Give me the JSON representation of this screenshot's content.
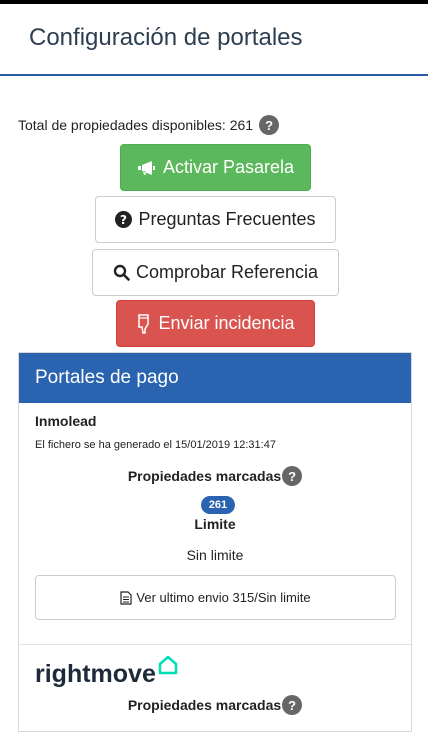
{
  "header": {
    "title": "Configuración de portales"
  },
  "summary": {
    "total_label": "Total de propiedades disponibles: 261",
    "help_glyph": "?"
  },
  "actions": {
    "activate": "Activar Pasarela",
    "faq": "Preguntas Frecuentes",
    "check_ref": "Comprobar Referencia",
    "incident": "Enviar incidencia"
  },
  "panel": {
    "title": "Portales de pago",
    "portal_1": {
      "name": "Inmolead",
      "generated": "El fichero se ha generado el 15/01/2019 12:31:47",
      "props_label": "Propiedades marcadas",
      "count": "261",
      "limit_label": "Limite",
      "limit_value": "Sin limite",
      "last_send": "Ver ultimo envio 315/Sin limite"
    },
    "portal_2": {
      "logo_text": "rightmove",
      "props_label": "Propiedades marcadas"
    }
  },
  "colors": {
    "green": "#5cb85c",
    "red": "#d9534f",
    "blue": "#2a63b0",
    "rightmove_teal": "#00deb6"
  },
  "icons": [
    "megaphone-icon",
    "question-circle-icon",
    "search-icon",
    "thumbs-down-icon",
    "file-icon",
    "rightmove-house-icon"
  ]
}
